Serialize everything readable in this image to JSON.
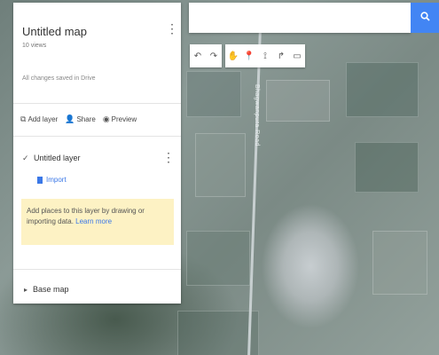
{
  "map_panel": {
    "title": "Untitled map",
    "views": "10 views",
    "save_status": "All changes saved in Drive"
  },
  "actions": {
    "add_layer": "Add layer",
    "share": "Share",
    "preview": "Preview"
  },
  "layer": {
    "name": "Untitled layer",
    "import": "Import",
    "hint": "Add places to this layer by drawing or importing data.",
    "hint_link": "Learn more"
  },
  "basemap": {
    "label": "Base map"
  },
  "search": {
    "placeholder": ""
  },
  "map": {
    "road_label": "Bhagwanpura Road"
  },
  "colors": {
    "accent": "#4285f4",
    "hint_bg": "#fdf2c4",
    "link": "#3b78e7"
  },
  "icons": {
    "search": "search-icon",
    "undo": "undo-icon",
    "redo": "redo-icon",
    "hand": "hand-icon",
    "marker": "marker-icon",
    "line": "draw-line-icon",
    "directions": "directions-icon",
    "ruler": "ruler-icon"
  }
}
